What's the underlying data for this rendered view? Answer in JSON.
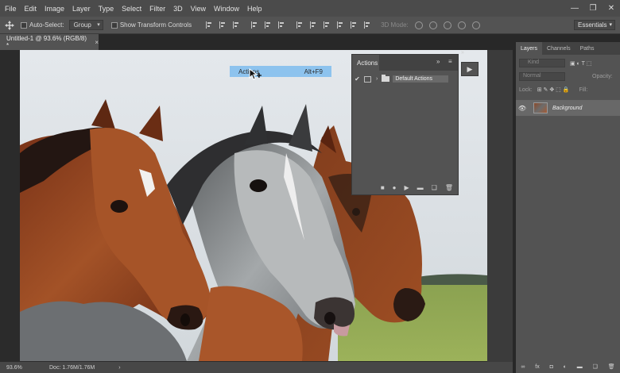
{
  "menu": [
    "File",
    "Edit",
    "Image",
    "Layer",
    "Type",
    "Select",
    "Filter",
    "3D",
    "View",
    "Window",
    "Help"
  ],
  "window_controls": {
    "minimize": "—",
    "restore": "❐",
    "close": "✕"
  },
  "options": {
    "auto_select_label": "Auto-Select:",
    "auto_select_value": "Group",
    "show_transform_label": "Show Transform Controls",
    "mode_3d_label": "3D Mode:",
    "workspace": "Essentials"
  },
  "document": {
    "tab_title": "Untitled-1 @ 93.6% (RGB/8) *",
    "tab_close": "×",
    "status_zoom": "93.6%",
    "status_doc": "Doc: 1.76M/1.76M",
    "status_arrow": "›"
  },
  "tooltip": {
    "label": "Actions",
    "shortcut": "Alt+F9"
  },
  "actions_panel": {
    "title": "Actions",
    "menu_glyph": "≡",
    "collapse_glyph": "»",
    "items": [
      {
        "checked": "✔",
        "expand": "›",
        "label": "Default Actions"
      }
    ],
    "footer": [
      "■",
      "●",
      "▶",
      "▬",
      "❑",
      "🗑"
    ],
    "play_glyph": "▶"
  },
  "layers_panel": {
    "tabs": [
      "Layers",
      "Channels",
      "Paths"
    ],
    "kind_placeholder": "Kind",
    "blend_mode": "Normal",
    "opacity_label": "Opacity:",
    "lock_label": "Lock:",
    "fill_label": "Fill:",
    "layers": [
      {
        "visible_glyph": "👁",
        "name": "Background"
      }
    ],
    "footer": [
      "∞",
      "fx",
      "◘",
      "◐",
      "▬",
      "❑",
      "🗑"
    ]
  }
}
